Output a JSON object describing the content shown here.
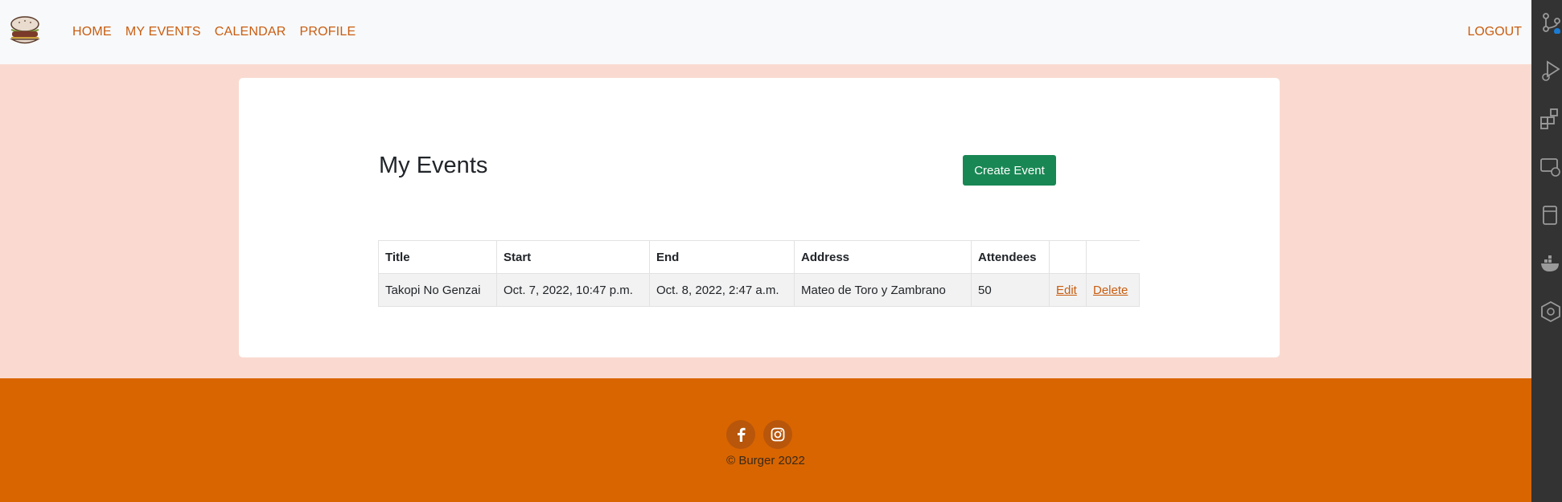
{
  "nav": {
    "links": [
      "HOME",
      "MY EVENTS",
      "CALENDAR",
      "PROFILE"
    ],
    "logout": "LOGOUT",
    "accent_color": "#c95d10"
  },
  "main": {
    "title": "My Events",
    "create_button": "Create Event",
    "table": {
      "headers": [
        "Title",
        "Start",
        "End",
        "Address",
        "Attendees"
      ],
      "rows": [
        {
          "title": "Takopi No Genzai",
          "start": "Oct. 7, 2022, 10:47 p.m.",
          "end": "Oct. 8, 2022, 2:47 a.m.",
          "address": "Mateo de Toro y Zambrano",
          "attendees": "50",
          "edit": "Edit",
          "delete": "Delete"
        }
      ]
    }
  },
  "footer": {
    "social": [
      "facebook-icon",
      "instagram-icon"
    ],
    "copyright": "© Burger 2022",
    "background": "#d96500"
  },
  "colors": {
    "page_bg": "#fadad0",
    "button_green": "#198754"
  }
}
